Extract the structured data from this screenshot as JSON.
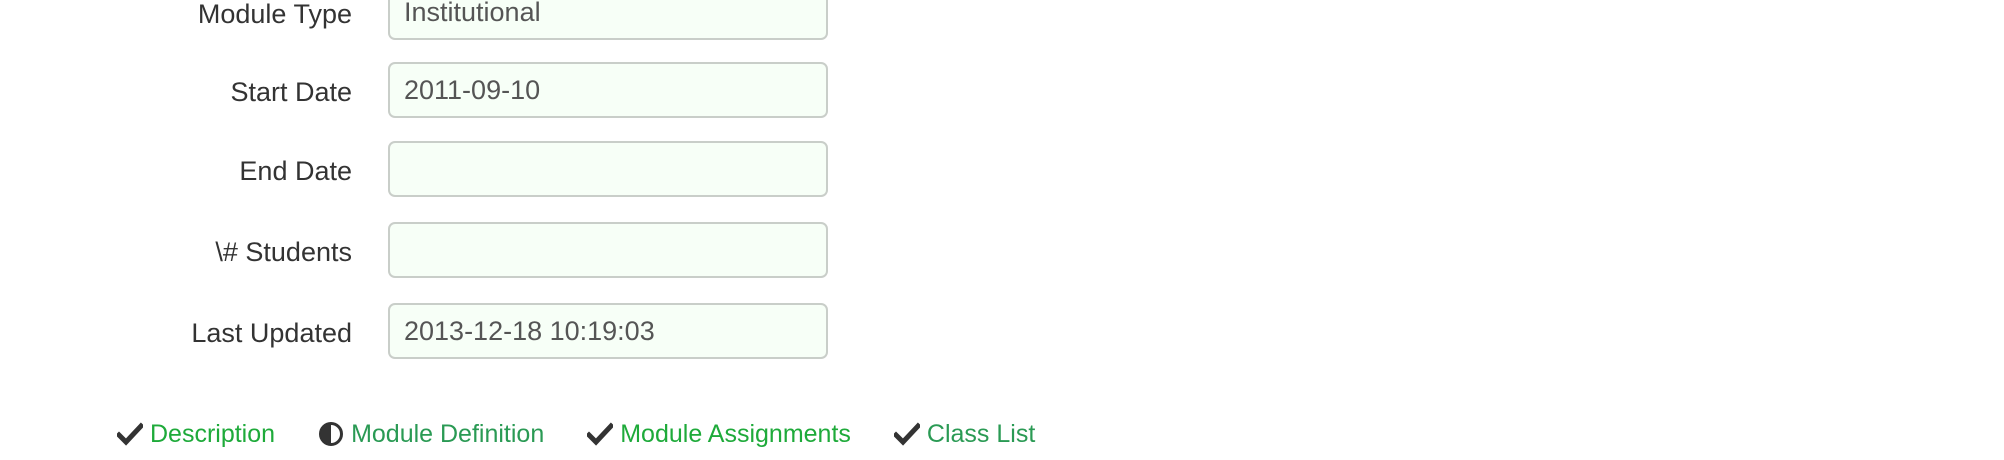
{
  "form": {
    "fields": [
      {
        "label": "Module Type",
        "value": "Institutional"
      },
      {
        "label": "Start Date",
        "value": "2011-09-10"
      },
      {
        "label": "End Date",
        "value": ""
      },
      {
        "label": "\\# Students",
        "value": ""
      },
      {
        "label": "Last Updated",
        "value": "2013-12-18 10:19:03"
      }
    ]
  },
  "status_links": [
    {
      "label": "Description",
      "icon": "checkmark-icon"
    },
    {
      "label": "Module Definition",
      "icon": "half-circle-icon"
    },
    {
      "label": "Module Assignments",
      "icon": "checkmark-icon"
    },
    {
      "label": "Class List",
      "icon": "checkmark-icon"
    }
  ],
  "colors": {
    "link_green": "#1eaa3a",
    "field_background": "#f7fff7",
    "field_border": "#c9cec9"
  }
}
